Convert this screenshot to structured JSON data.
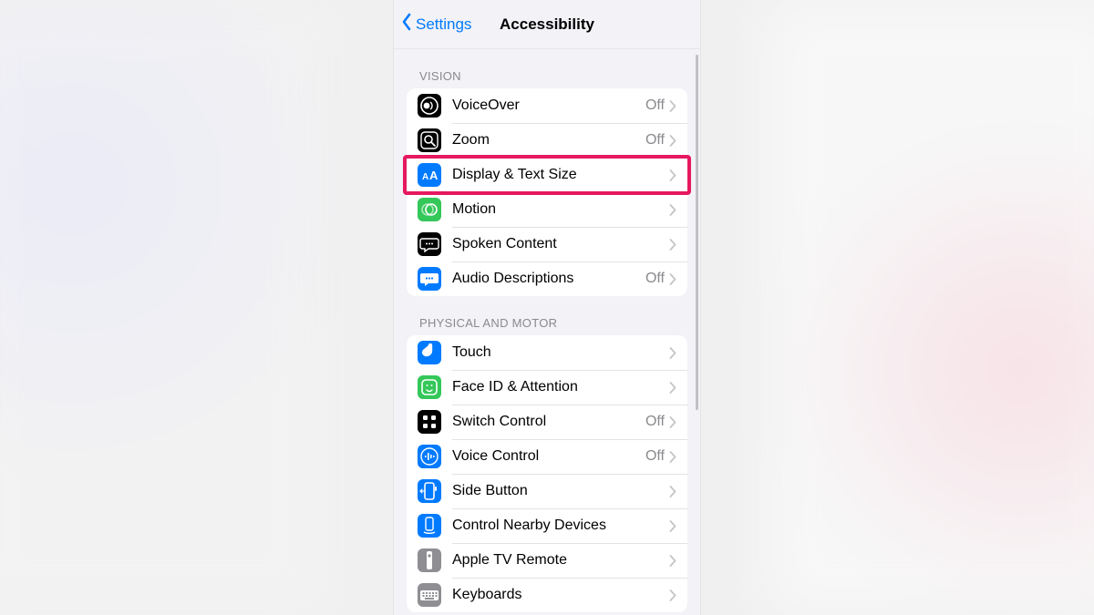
{
  "nav": {
    "back_label": "Settings",
    "title": "Accessibility"
  },
  "sections": [
    {
      "header": "VISION",
      "rows": [
        {
          "id": "voiceover",
          "label": "VoiceOver",
          "status": "Off",
          "icon": "voiceover-icon",
          "icon_bg": "ic-black",
          "glyph": "vo"
        },
        {
          "id": "zoom",
          "label": "Zoom",
          "status": "Off",
          "icon": "zoom-icon",
          "icon_bg": "ic-black",
          "glyph": "zoom"
        },
        {
          "id": "display-text",
          "label": "Display & Text Size",
          "status": "",
          "icon": "text-size-icon",
          "icon_bg": "ic-blue",
          "glyph": "aa",
          "highlighted": true
        },
        {
          "id": "motion",
          "label": "Motion",
          "status": "",
          "icon": "motion-icon",
          "icon_bg": "ic-green",
          "glyph": "motion"
        },
        {
          "id": "spoken-content",
          "label": "Spoken Content",
          "status": "",
          "icon": "spoken-icon",
          "icon_bg": "ic-black",
          "glyph": "bubble"
        },
        {
          "id": "audio-desc",
          "label": "Audio Descriptions",
          "status": "Off",
          "icon": "audio-desc-icon",
          "icon_bg": "ic-blue",
          "glyph": "bubble-fill"
        }
      ]
    },
    {
      "header": "PHYSICAL AND MOTOR",
      "rows": [
        {
          "id": "touch",
          "label": "Touch",
          "status": "",
          "icon": "touch-icon",
          "icon_bg": "ic-blue",
          "glyph": "touch"
        },
        {
          "id": "faceid",
          "label": "Face ID & Attention",
          "status": "",
          "icon": "faceid-icon",
          "icon_bg": "ic-green",
          "glyph": "face"
        },
        {
          "id": "switch-control",
          "label": "Switch Control",
          "status": "Off",
          "icon": "switch-icon",
          "icon_bg": "ic-black",
          "glyph": "grid"
        },
        {
          "id": "voice-control",
          "label": "Voice Control",
          "status": "Off",
          "icon": "voice-control-icon",
          "icon_bg": "ic-blue",
          "glyph": "voice"
        },
        {
          "id": "side-button",
          "label": "Side Button",
          "status": "",
          "icon": "side-button-icon",
          "icon_bg": "ic-blue",
          "glyph": "side"
        },
        {
          "id": "nearby",
          "label": "Control Nearby Devices",
          "status": "",
          "icon": "nearby-icon",
          "icon_bg": "ic-blue",
          "glyph": "nearby"
        },
        {
          "id": "appletv",
          "label": "Apple TV Remote",
          "status": "",
          "icon": "appletv-icon",
          "icon_bg": "ic-gray",
          "glyph": "remote"
        },
        {
          "id": "keyboards",
          "label": "Keyboards",
          "status": "",
          "icon": "keyboard-icon",
          "icon_bg": "ic-gray",
          "glyph": "keyboard"
        }
      ]
    }
  ]
}
